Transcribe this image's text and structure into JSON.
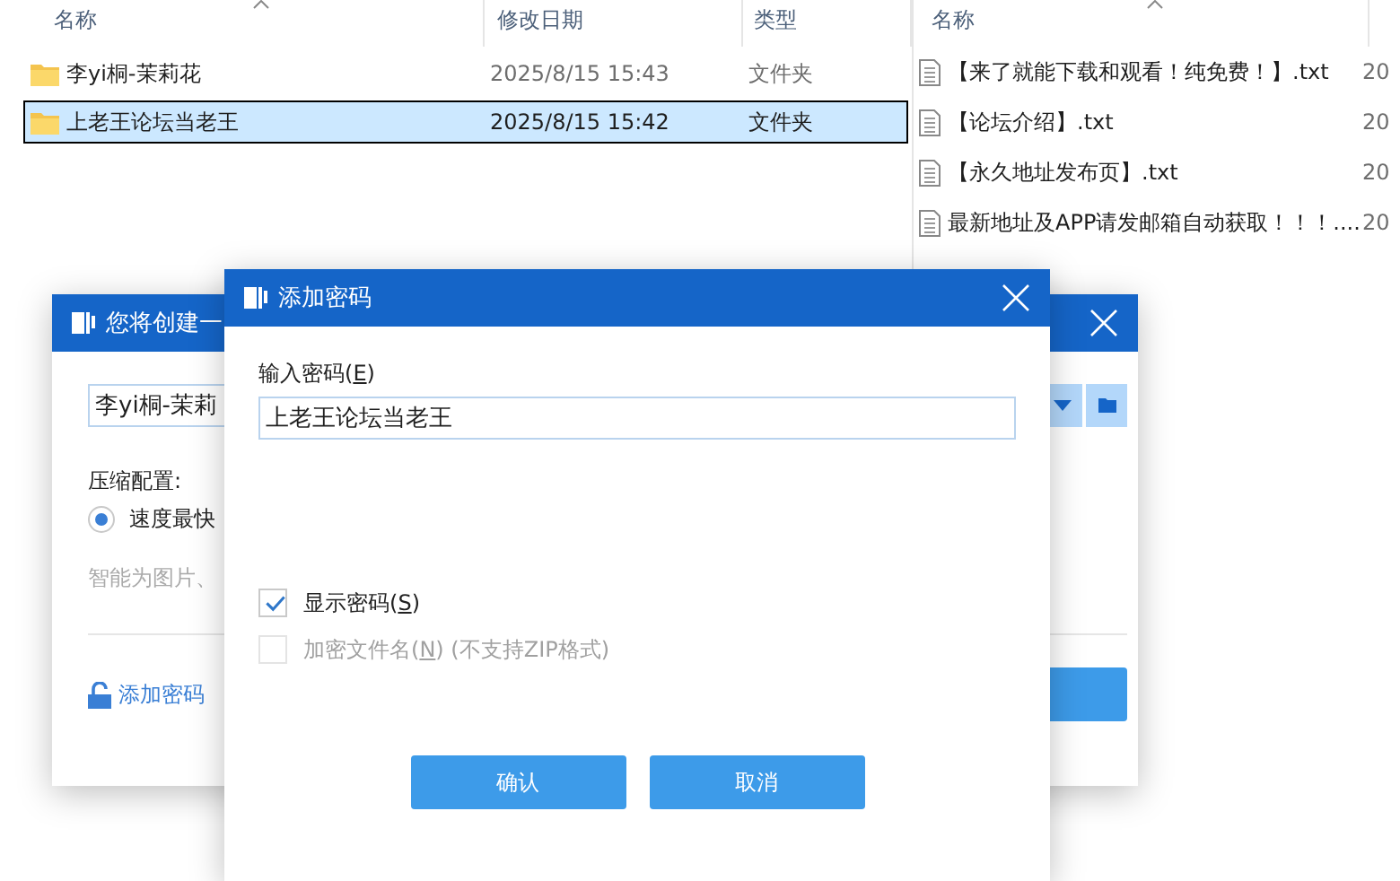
{
  "left_pane": {
    "columns": [
      "名称",
      "修改日期",
      "类型"
    ],
    "rows": [
      {
        "name": "李yi桐-茉莉花",
        "modified": "2025/8/15 15:43",
        "type": "文件夹",
        "selected": false
      },
      {
        "name": "上老王论坛当老王",
        "modified": "2025/8/15 15:42",
        "type": "文件夹",
        "selected": true
      }
    ]
  },
  "right_pane": {
    "columns": [
      "名称"
    ],
    "rows": [
      {
        "name": "【来了就能下载和观看！纯免费！】.txt",
        "column_2": "20"
      },
      {
        "name": "【论坛介绍】.txt",
        "column_2": "20"
      },
      {
        "name": "【永久地址发布页】.txt",
        "column_2": "20"
      },
      {
        "name": "最新地址及APP请发邮箱自动获取！！！....",
        "column_2": "20"
      }
    ]
  },
  "archive_dialog": {
    "title": "您将创建一",
    "archive_name": "李yi桐-茉莉",
    "section_label": "压缩配置:",
    "options": [
      {
        "label": "速度最快",
        "selected": true
      }
    ],
    "hint": "智能为图片、",
    "password_link": "添加密码"
  },
  "password_dialog": {
    "title": "添加密码",
    "field_label": {
      "text": "输入密码(",
      "access_key": "E",
      "after": ")"
    },
    "password": "上老王论坛当老王",
    "checkboxes": [
      {
        "text": "显示密码(",
        "access_key": "S",
        "after": ")",
        "checked": true,
        "disabled": false
      },
      {
        "text": "加密文件名(",
        "access_key": "N",
        "after": ") (不支持ZIP格式)",
        "checked": false,
        "disabled": true
      }
    ],
    "buttons": [
      "确认",
      "取消"
    ]
  }
}
